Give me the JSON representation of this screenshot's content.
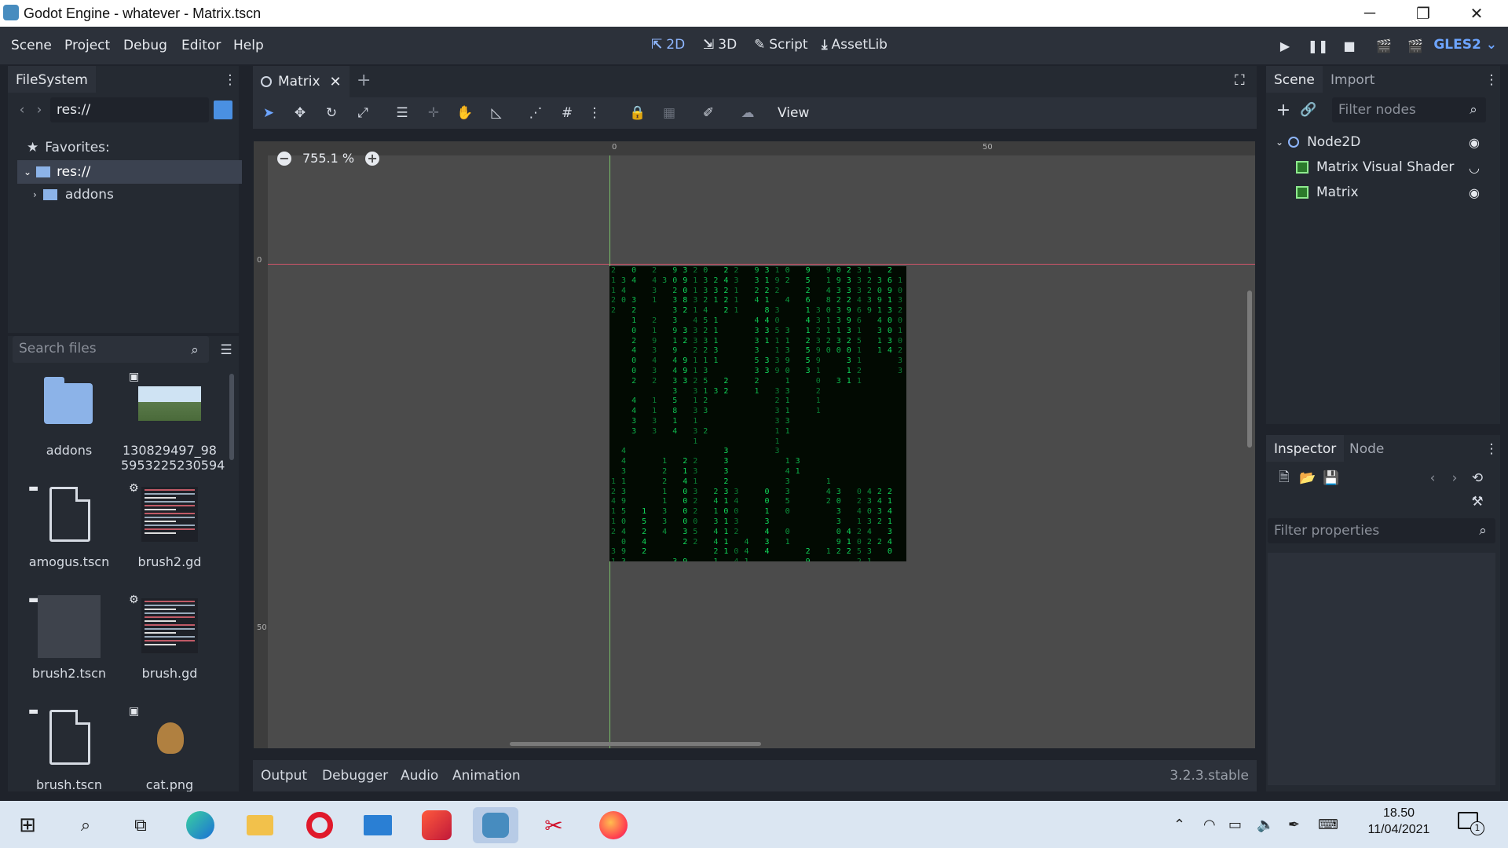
{
  "window": {
    "title": "Godot Engine - whatever - Matrix.tscn",
    "controls": [
      "─",
      "❐",
      "✕"
    ]
  },
  "menubar": {
    "items": [
      "Scene",
      "Project",
      "Debug",
      "Editor",
      "Help"
    ],
    "workspaces": [
      {
        "label": "2D",
        "icon": "2d-icon",
        "active": true
      },
      {
        "label": "3D",
        "icon": "3d-icon",
        "active": false
      },
      {
        "label": "Script",
        "icon": "script-icon",
        "active": false
      },
      {
        "label": "AssetLib",
        "icon": "assetlib-icon",
        "active": false
      }
    ],
    "renderer": "GLES2"
  },
  "filesystem": {
    "tab": "FileSystem",
    "path": "res://",
    "favorites_label": "Favorites:",
    "tree": [
      {
        "label": "res://",
        "selected": true
      },
      {
        "label": "addons",
        "selected": false
      }
    ],
    "search_placeholder": "Search files",
    "files": [
      {
        "name": "addons",
        "kind": "folder"
      },
      {
        "name": "130829497_98\n5953225230594",
        "kind": "image"
      },
      {
        "name": "amogus.tscn",
        "kind": "scene"
      },
      {
        "name": "brush2.gd",
        "kind": "script"
      },
      {
        "name": "brush2.tscn",
        "kind": "scene-preview"
      },
      {
        "name": "brush.gd",
        "kind": "script"
      },
      {
        "name": "brush.tscn",
        "kind": "scene"
      },
      {
        "name": "cat.png",
        "kind": "image"
      }
    ]
  },
  "editor": {
    "tab": "Matrix",
    "toolbar_view": "View",
    "zoom": "755.1 %",
    "ruler_labels": {
      "top_0": "0",
      "top_50": "50",
      "left_0": "0",
      "left_50": "50"
    }
  },
  "matrix_columns": [
    "2\n1\n1\n2\n2\n\n\n\n\n\n\n\n\n\n\n\n\n\n\n\n\n1\n2\n4\n1\n1\n2\n\n3\n1\n8",
    "\n3\n4\n0\n\n\n\n\n\n\n\n\n\n\n\n\n\n\n4\n4\n3\n1\n3\n9\n5\n0\n4\n0\n9\n3\n1",
    "0\n4\n\n3\n2\n1\n0\n2\n4\n0\n0\n2\n\n4\n4\n3\n3\n\n\n\n\n\n\n\n\n\n\n\n\n\n2",
    "\n\n\n\n\n\n\n\n\n\n\n\n\n\n\n\n\n\n\n\n\n\n\n\n1\n5\n2\n4\n2\n\n\n3",
    "2\n4\n3\n1\n\n2\n1\n9\n3\n4\n3\n2\n\n1\n1\n3\n3\n\n\n\n\n\n\n\n\n\n\n\n\n\n3",
    "\n3\n\n\n\n\n\n\n\n\n\n\n\n\n\n\n\n\n\n1\n2\n2\n1\n1\n3\n3\n4\n\n\n",
    "9\n0\n2\n3\n3\n3\n9\n1\n9\n4\n4\n3\n3\n5\n8\n1\n4\n\n\n\n\n\n\n\n\n\n\n\n\n3",
    "3\n9\n0\n8\n2\n\n3\n2\n\n9\n9\n3\n\n\n\n\n\n\n\n2\n1\n4\n0\n0\n0\n0\n3\n2\n\n9",
    "2\n1\n1\n3\n1\n4\n3\n3\n2\n1\n1\n2\n3\n1\n3\n1\n3\n1\n\n2\n3\n1\n3\n2\n2\n0\n5\n2",
    "0\n3\n3\n2\n4\n5\n2\n3\n2\n1\n3\n5\n1\n2\n3\n\n2",
    "\n2\n3\n1\n\n1\n1\n1\n3\n1\n\n\n3\n\n\n\n\n\n\n\n\n\n2\n4\n1\n3\n4\n4\n2\n1\n3",
    "2\n4\n2\n2\n2\n\n\n\n\n\n\n2\n2\n\n\n\n\n\n3\n3\n3\n2\n3\n1\n0\n1\n1\n1\n1",
    "2\n3\n1\n1\n1\n\n\n\n\n\n\n\n\n\n\n\n\n\n\n\n\n\n3\n4\n0\n3\n2\n\n0\n4\n1",
    "\n\n\n\n\n\n\n\n\n\n\n\n\n\n\n\n\n\n\n\n\n\n\n\n\n\n\n4\n4\n1",
    "9\n3\n2\n4\n\n4\n3\n3\n3\n5\n3\n2\n1\n\n\n\n\n\n\n\n\n\n\n\n\n\n\n\n\n\n3",
    "3\n1\n2\n1\n8\n4\n3\n1\n\n3\n3\n\n\n\n\n\n\n\n\n\n\n\n0\n0\n1\n3\n4\n3\n4\n\n",
    "1\n9\n2\n\n3\n0\n5\n1\n1\n3\n9\n\n3\n2\n3\n3\n1\n1\n3\n\n\n\n\n\n\n\n\n\n\n\n4",
    "0\n2\n\n4\n\n\n3\n1\n3\n9\n0\n1\n3\n1\n1\n3\n1\n\n\n1\n4\n3\n3\n5\n0\n\n0\n1",
    "\n\n\n\n\n\n\n\n\n\n\n\n\n\n\n\n\n\n\n3\n1\n\n\n\n\n\n\n\n\n\n\n",
    "9\n5\n2\n6\n1\n4\n1\n2\n5\n5\n3\n\n\n\n\n\n\n\n\n\n\n\n\n\n\n\n\n\n2\n9\n",
    "\n\n\n\n3\n3\n2\n3\n9\n9\n1\n0\n2\n1\n1\n\n\n\n\n\n\n\n\n\n\n\n\n\n\n\n\n",
    "9\n1\n4\n8\n0\n1\n1\n2\n0\n\n\n\n\n\n\n\n\n\n\n\n\n1\n4\n2\n\n\n\n\n1\n\n2",
    "0\n9\n3\n2\n3\n3\n1\n3\n0\n\n\n3\n\n\n\n\n\n\n\n\n\n\n3\n0\n3\n3\n0\n9\n2\n\n0",
    "2\n3\n3\n2\n9\n9\n3\n2\n0\n3\n1\n1\n\n\n\n\n\n\n\n\n\n\n\n\n\n\n4\n1\n2\n\n3",
    "3\n3\n3\n4\n6\n6\n1\n5\n1\n1\n2\n1\n\n\n\n\n\n\n\n\n\n\n0\n2\n4\n1\n2\n0\n5\n2",
    "1\n2\n2\n3\n9\n\n\n\n\n\n\n\n\n\n\n\n\n\n\n\n\n\n4\n3\n0\n3\n4\n2\n3\n1\n1",
    "\n3\n0\n9\n1\n4\n3\n1\n1\n\n\n\n\n\n\n\n\n\n\n\n\n\n2\n4\n3\n2\n\n2\n\n\n",
    "2\n6\n9\n1\n3\n0\n0\n3\n4\n\n\n\n\n\n\n\n\n\n\n\n\n\n2\n1\n4\n1\n3\n4\n0\n\n4",
    "\n1\n0\n3\n2\n0\n1\n0\n2\n3\n3\n\n\n\n\n\n\n\n\n\n\n\n\n\n\n\n\n\n\n\n"
  ],
  "bottom_panel": {
    "tabs": [
      "Output",
      "Debugger",
      "Audio",
      "Animation"
    ],
    "version": "3.2.3.stable"
  },
  "scene_dock": {
    "tabs": [
      "Scene",
      "Import"
    ],
    "filter_placeholder": "Filter nodes",
    "nodes": [
      {
        "label": "Node2D",
        "depth": 0,
        "icon": "node2d-icon",
        "visibility": "eye-icon"
      },
      {
        "label": "Matrix Visual Shader",
        "depth": 1,
        "icon": "sprite-icon",
        "visibility": "eye-closed-icon"
      },
      {
        "label": "Matrix",
        "depth": 1,
        "icon": "sprite-icon",
        "visibility": "eye-icon"
      }
    ]
  },
  "inspector": {
    "tabs": [
      "Inspector",
      "Node"
    ],
    "filter_placeholder": "Filter properties"
  },
  "taskbar": {
    "apps": [
      "windows-start",
      "search",
      "task-view",
      "edge",
      "file-explorer",
      "opera",
      "mail",
      "candy-crush",
      "godot",
      "snip",
      "firefox"
    ],
    "active_app": "godot",
    "time": "18.50",
    "date": "11/04/2021",
    "notification_count": "1"
  },
  "colors": {
    "accent": "#8fb7ff",
    "matrix_green": "#11d85a",
    "viewport": "#4b4b4b"
  }
}
